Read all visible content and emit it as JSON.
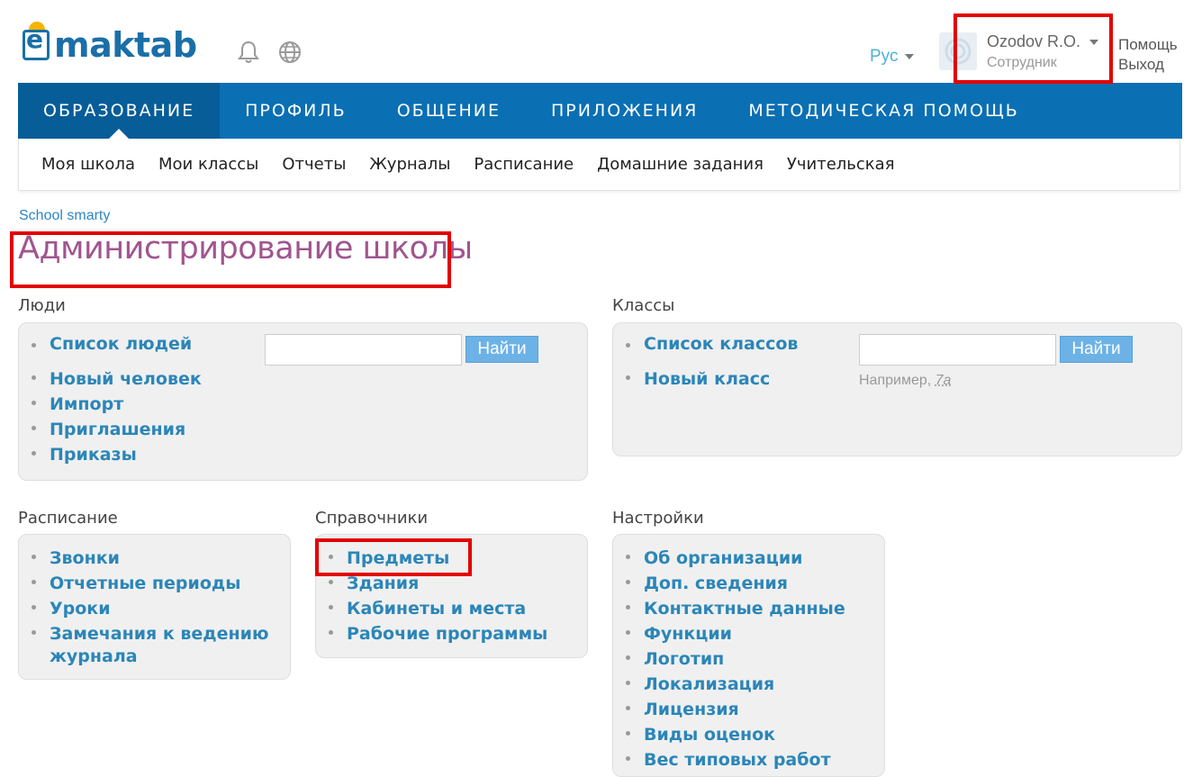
{
  "header": {
    "logo_letter": "e",
    "logo_text": "maktab",
    "icons": [
      "bell-icon",
      "globe-icon"
    ],
    "language": "Рус",
    "user_name": "Ozodov R.O.",
    "user_role": "Сотрудник",
    "help_link": "Помощь",
    "logout_link": "Выход"
  },
  "main_nav": [
    {
      "label": "ОБРАЗОВАНИЕ",
      "active": true
    },
    {
      "label": "ПРОФИЛЬ"
    },
    {
      "label": "ОБЩЕНИЕ"
    },
    {
      "label": "ПРИЛОЖЕНИЯ"
    },
    {
      "label": "МЕТОДИЧЕСКАЯ ПОМОЩЬ"
    }
  ],
  "sub_nav": [
    "Моя школа",
    "Мои классы",
    "Отчеты",
    "Журналы",
    "Расписание",
    "Домашние задания",
    "Учительская"
  ],
  "breadcrumb": "School smarty",
  "page_title": "Администрирование школы",
  "sections": {
    "people": {
      "title": "Люди",
      "items": [
        "Список людей",
        "Новый человек",
        "Импорт",
        "Приглашения",
        "Приказы"
      ],
      "search_button": "Найти"
    },
    "classes": {
      "title": "Классы",
      "items": [
        "Список классов",
        "Новый класс"
      ],
      "search_button": "Найти",
      "hint_prefix": "Например,",
      "hint_example": "7а"
    },
    "schedule": {
      "title": "Расписание",
      "items": [
        "Звонки",
        "Отчетные периоды",
        "Уроки",
        "Замечания к ведению журнала"
      ]
    },
    "references": {
      "title": "Справочники",
      "items": [
        "Предметы",
        "Здания",
        "Кабинеты и места",
        "Рабочие программы"
      ]
    },
    "settings": {
      "title": "Настройки",
      "items": [
        "Об организации",
        "Доп. сведения",
        "Контактные данные",
        "Функции",
        "Логотип",
        "Локализация",
        "Лицензия",
        "Виды оценок",
        "Вес типовых работ"
      ]
    }
  },
  "colors": {
    "nav_blue": "#0a6fb3",
    "title_purple": "#a0558f",
    "link_blue": "#2b86b8",
    "highlight_red": "#e30000"
  }
}
